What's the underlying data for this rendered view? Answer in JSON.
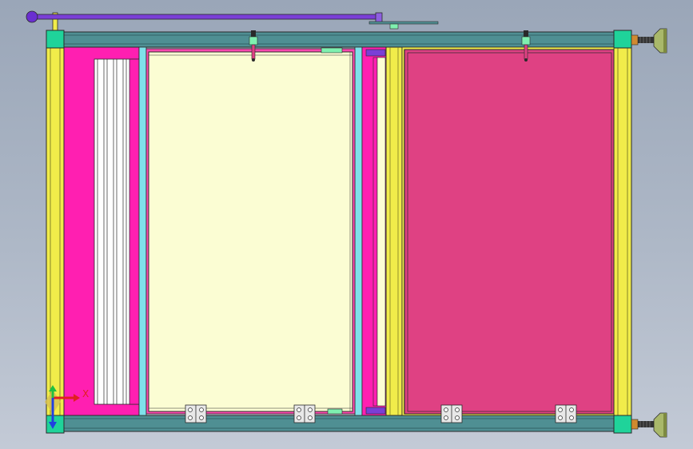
{
  "viewport": {
    "background_top": "#9aa6b8",
    "background_bottom": "#c3cad6"
  },
  "colors": {
    "frame_teal": "#4f8f93",
    "corner_green": "#1fd39a",
    "post_yellow": "#f1ec4a",
    "panel_magenta": "#ff1fb1",
    "panel_cream": "#fbfdd3",
    "panel_crimson": "#df4183",
    "rail_cyan": "#7fe1ea",
    "handle_purple": "#7a3fd6",
    "outline": "#2a2a2a"
  },
  "triad": {
    "x_label": "X",
    "x_color": "#e02020",
    "y_color": "#20c040",
    "z_color": "#2040e0"
  },
  "icons": {
    "triad": "coordinate-axis-icon",
    "hinge": "hinge-icon",
    "foot": "leveling-foot-icon",
    "handle": "lever-handle-icon",
    "latch": "latch-icon"
  }
}
